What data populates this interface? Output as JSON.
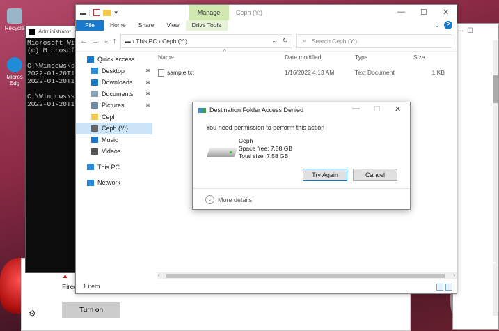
{
  "desktop": {
    "icons": [
      {
        "label": "Recycle",
        "color": "#9ab4c8"
      },
      {
        "label": "Micros Edg",
        "color": "#1f8cd6"
      }
    ]
  },
  "cmd": {
    "title": "Administrator",
    "lines": [
      "Microsoft Win",
      "(c) Microsoft",
      "",
      "C:\\Windows\\sy",
      "2022-01-20T11",
      "2022-01-20T11",
      "",
      "C:\\Windows\\sy",
      "2022-01-20T11"
    ]
  },
  "settings": {
    "firewall_label": "Firew",
    "turn_on": "Turn on"
  },
  "explorer": {
    "manage_tab": "Manage",
    "title": "Ceph (Y:)",
    "ribbon": [
      "File",
      "Home",
      "Share",
      "View",
      "Drive Tools"
    ],
    "address": [
      "This PC",
      "Ceph (Y:)"
    ],
    "search_placeholder": "Search Ceph (Y:)",
    "nav": [
      {
        "label": "Quick access",
        "icon": "star-icon",
        "color": "#1979ca",
        "sub": false,
        "pin": false,
        "sel": false
      },
      {
        "label": "Desktop",
        "icon": "desktop-icon",
        "color": "#2a8ad8",
        "sub": true,
        "pin": true,
        "sel": false
      },
      {
        "label": "Downloads",
        "icon": "download-icon",
        "color": "#1979ca",
        "sub": true,
        "pin": true,
        "sel": false
      },
      {
        "label": "Documents",
        "icon": "documents-icon",
        "color": "#8aa0b5",
        "sub": true,
        "pin": true,
        "sel": false
      },
      {
        "label": "Pictures",
        "icon": "pictures-icon",
        "color": "#6e8aa8",
        "sub": true,
        "pin": true,
        "sel": false
      },
      {
        "label": "Ceph",
        "icon": "folder-icon",
        "color": "#f2c94c",
        "sub": true,
        "pin": false,
        "sel": false
      },
      {
        "label": "Ceph (Y:)",
        "icon": "drive-icon",
        "color": "#666666",
        "sub": true,
        "pin": false,
        "sel": true
      },
      {
        "label": "Music",
        "icon": "music-icon",
        "color": "#1979ca",
        "sub": true,
        "pin": false,
        "sel": false
      },
      {
        "label": "Videos",
        "icon": "videos-icon",
        "color": "#555555",
        "sub": true,
        "pin": false,
        "sel": false
      },
      {
        "label": "This PC",
        "icon": "computer-icon",
        "color": "#2a8ad8",
        "sub": false,
        "pin": false,
        "sel": false
      },
      {
        "label": "Network",
        "icon": "network-icon",
        "color": "#2a8ad8",
        "sub": false,
        "pin": false,
        "sel": false
      }
    ],
    "columns": [
      "Name",
      "Date modified",
      "Type",
      "Size"
    ],
    "files": [
      {
        "name": "sample.txt",
        "date": "1/16/2022 4:13 AM",
        "type": "Text Document",
        "size": "1 KB"
      }
    ],
    "status": "1 item"
  },
  "dialog": {
    "title": "Destination Folder Access Denied",
    "message": "You need permission to perform this action",
    "drive_name": "Ceph",
    "space_free": "Space free: 7.58 GB",
    "total_size": "Total size: 7.58 GB",
    "try_again": "Try Again",
    "cancel": "Cancel",
    "more_details": "More details"
  }
}
